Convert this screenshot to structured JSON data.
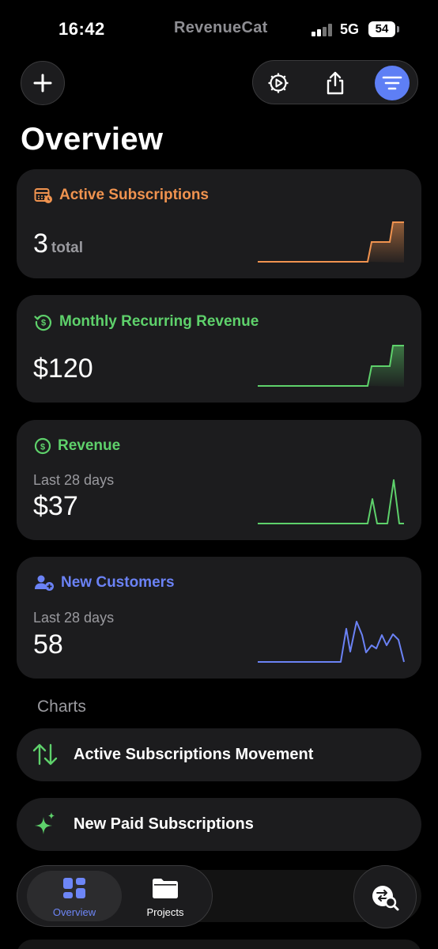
{
  "status_bar": {
    "time": "16:42",
    "app_name": "RevenueCat",
    "network": "5G",
    "battery": "54"
  },
  "header": {
    "title": "Overview",
    "add_icon": "plus-icon",
    "settings_icon": "gear-play-icon",
    "share_icon": "share-icon",
    "filter_icon": "filter-lines-icon"
  },
  "cards": [
    {
      "title": "Active Subscriptions",
      "value": "3",
      "unit": "total",
      "color": "#f0934f",
      "icon": "calendar-clock-icon"
    },
    {
      "title": "Monthly Recurring Revenue",
      "value": "$120",
      "color": "#5ed16b",
      "icon": "dollar-refresh-icon"
    },
    {
      "title": "Revenue",
      "subtitle": "Last 28 days",
      "value": "$37",
      "color": "#5ed16b",
      "icon": "dollar-circle-icon"
    },
    {
      "title": "New Customers",
      "subtitle": "Last 28 days",
      "value": "58",
      "color": "#6b82f5",
      "icon": "person-add-icon"
    }
  ],
  "charts_section": {
    "label": "Charts",
    "items": [
      {
        "label": "Active Subscriptions Movement",
        "icon": "up-down-arrows-icon"
      },
      {
        "label": "New Paid Subscriptions",
        "icon": "sparkles-icon"
      }
    ]
  },
  "tabbar": {
    "tabs": [
      {
        "label": "Overview",
        "icon": "dashboard-icon",
        "active": true
      },
      {
        "label": "Projects",
        "icon": "folder-icon",
        "active": false
      }
    ],
    "fab_icon": "switch-search-icon"
  },
  "colors": {
    "accent_blue": "#5e7ff5",
    "orange": "#f0934f",
    "green": "#5ed16b",
    "indigo": "#6b82f5"
  }
}
